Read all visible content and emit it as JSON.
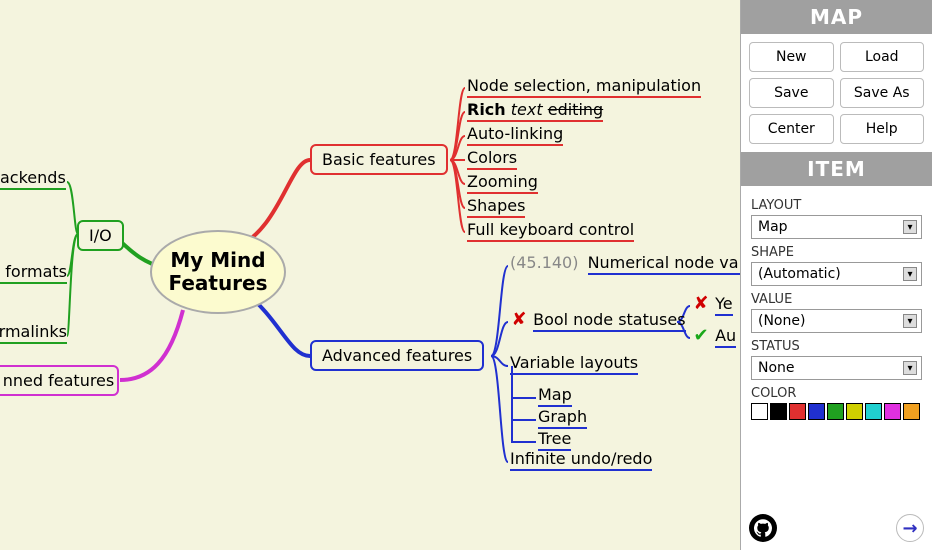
{
  "root": {
    "line1": "My Mind",
    "line2": "Features"
  },
  "io": {
    "label": "I/O",
    "backends": "ackends",
    "formats": "e formats",
    "permalinks": "ermalinks"
  },
  "planned": {
    "label": "nned features"
  },
  "basic": {
    "label": "Basic features",
    "color": "#e03030",
    "items": [
      "Node selection, manipulation",
      "Rich text editing",
      "Auto-linking",
      "Colors",
      "Zooming",
      "Shapes",
      "Full keyboard control"
    ]
  },
  "advanced": {
    "label": "Advanced features",
    "color": "#2030d0",
    "numerical": {
      "value_prefix": "(45.140)",
      "label": "Numerical node valu"
    },
    "bool": {
      "label": "Bool node statuses",
      "yes": "Ye",
      "auto": "Au"
    },
    "variable": {
      "label": "Variable layouts",
      "items": [
        "Map",
        "Graph",
        "Tree"
      ]
    },
    "undo": "Infinite undo/redo"
  },
  "panel": {
    "map_title": "MAP",
    "item_title": "ITEM",
    "buttons": {
      "new": "New",
      "load": "Load",
      "save": "Save",
      "save_as": "Save As",
      "center": "Center",
      "help": "Help"
    },
    "layout": {
      "label": "LAYOUT",
      "value": "Map"
    },
    "shape": {
      "label": "SHAPE",
      "value": "(Automatic)"
    },
    "value": {
      "label": "VALUE",
      "value": "(None)"
    },
    "status": {
      "label": "STATUS",
      "value": "None"
    },
    "color": {
      "label": "COLOR"
    },
    "swatches": [
      "#ffffff",
      "#000000",
      "#e03030",
      "#2030d0",
      "#20a020",
      "#d0d000",
      "#20d0d0",
      "#e030e0",
      "#f0a020"
    ]
  }
}
